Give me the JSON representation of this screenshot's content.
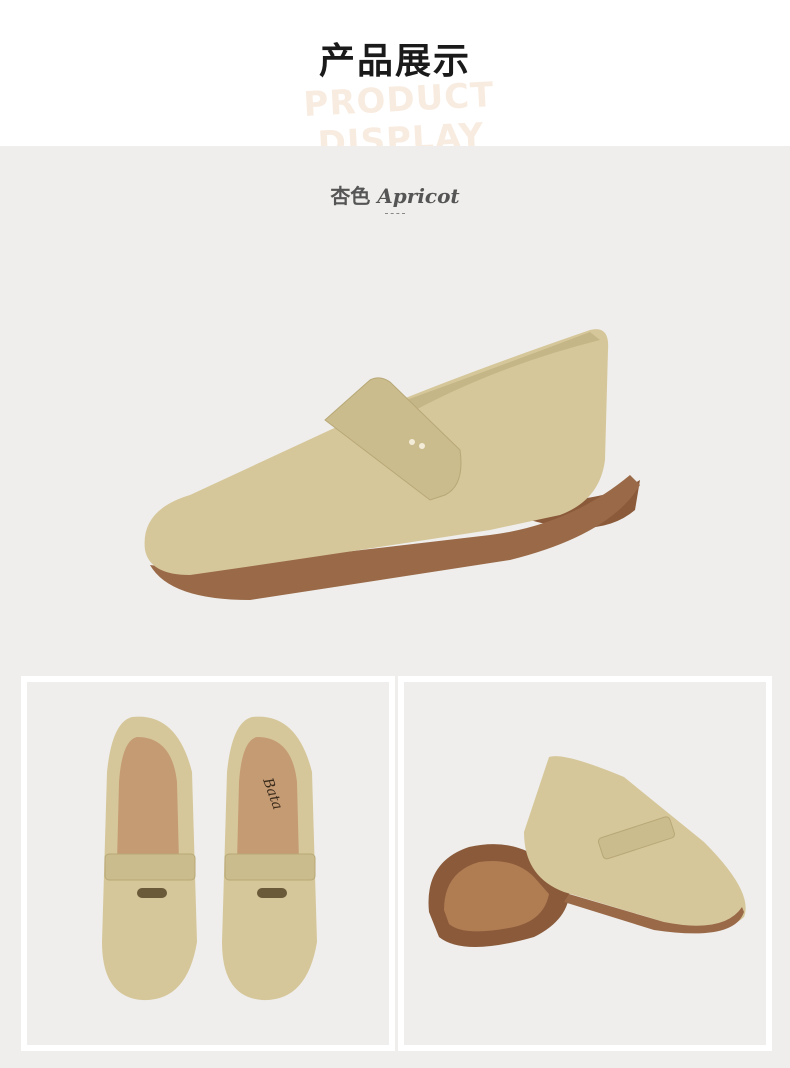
{
  "header": {
    "title_cn": "产品展示",
    "title_en": "PRODUCT DISPLAY"
  },
  "product": {
    "color_cn": "杏色",
    "color_en": "Apricot",
    "brand_mark": "Bata"
  },
  "colors": {
    "suede": "#d6c79a",
    "sole": "#8a5a3a",
    "background": "#efeeec",
    "accent_text": "#f8ece1"
  }
}
